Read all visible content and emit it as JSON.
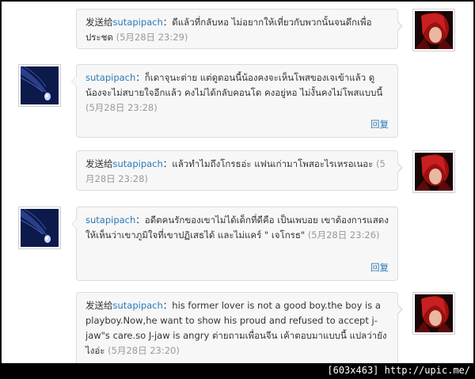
{
  "messages": [
    {
      "prefix": "发送给",
      "user": "sutapipach",
      "sep": "：",
      "text": "ดีแล้วที่กลับหอ ไม่อยากให้เที่ยวกับพวกนั้นจนดึกเพื่อประชด",
      "time": "(5月28日  23:29)"
    },
    {
      "prefix": "",
      "user": "sutapipach",
      "sep": "：",
      "text": "ก็เดาจุนะต่าย แต่ดูตอนนี้น้องคงจะเห็นโพสของเจเข้าแล้ว ดูน้องจะไม่สบายใจอีกแล้ว คงไม่ได้กลับคอนโด คงอยู่หอ ไม่งั้นคงไม่โพสแบบนี้",
      "time": "(5月28日  23:28)",
      "reply": "回复"
    },
    {
      "prefix": "发送给",
      "user": "sutapipach",
      "sep": "：",
      "text": "แล้วทำไมถึงโกรธอ่ะ แฟนเก่ามาโพสอะไรเหรอเนอะ",
      "time": "(5月28日  23:28)"
    },
    {
      "prefix": "",
      "user": "sutapipach",
      "sep": "：",
      "text": "อดีตคนรักของเขาไม่ได้เด็กที่ดีคือ เป็นเพบอย เขาต้องการแสดงให้เห็นว่าเขาภูมิใจที่เขาปฏิเสธได้ และไม่แคร์ \" เจโกรธ\"",
      "time": "(5月28日  23:26)",
      "reply": "回复"
    },
    {
      "prefix": "发送给",
      "user": "sutapipach",
      "sep": "：",
      "text": "his former lover is not a good boy.the boy is a playboy.Now,he want to show his proud and refused to accept j-jaw\"s care.so J-jaw is angry ต่ายถามเพื่อนจีน เค้าตอบมาแบบนี้ แปลว่ายังไงอ่ะ",
      "time": "(5月28日  23:20)"
    }
  ],
  "footer": {
    "text": "[603x463] http://upic.me/"
  }
}
